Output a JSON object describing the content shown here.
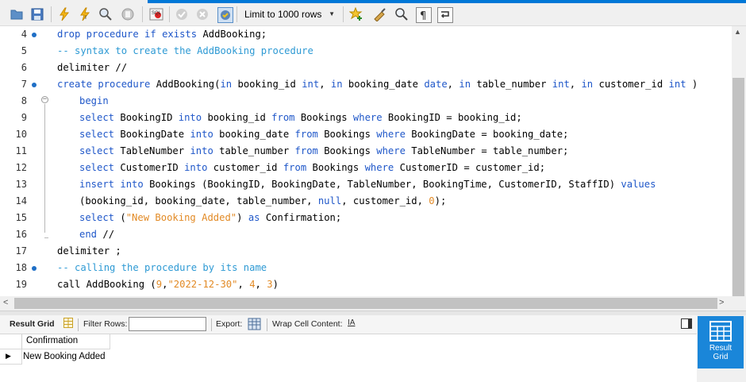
{
  "toolbar": {
    "limit_label": "Limit to 1000 rows",
    "icons": [
      "open-file-icon",
      "save-icon",
      "execute-icon",
      "execute-current-icon",
      "explain-icon",
      "stop-icon",
      "toggle-error-icon",
      "commit-icon",
      "rollback-icon",
      "autocommit-icon",
      "limit-dropdown",
      "bookmark-icon",
      "beautify-icon",
      "find-icon",
      "invisible-chars-icon",
      "wrap-icon"
    ]
  },
  "editor": {
    "lines": [
      {
        "num": "4",
        "marker": true,
        "tokens": [
          [
            "k",
            "drop procedure if exists "
          ],
          [
            "",
            "AddBooking;"
          ]
        ]
      },
      {
        "num": "5",
        "marker": false,
        "tokens": [
          [
            "c",
            "-- syntax to create the AddBooking procedure"
          ]
        ]
      },
      {
        "num": "6",
        "marker": false,
        "tokens": [
          [
            "",
            "delimiter //"
          ]
        ]
      },
      {
        "num": "7",
        "marker": true,
        "tokens": [
          [
            "k",
            "create procedure "
          ],
          [
            "",
            "AddBooking("
          ],
          [
            "k",
            "in "
          ],
          [
            "",
            "booking_id "
          ],
          [
            "k",
            "int"
          ],
          [
            "",
            ", "
          ],
          [
            "k",
            "in "
          ],
          [
            "",
            "booking_date "
          ],
          [
            "k",
            "date"
          ],
          [
            "",
            ", "
          ],
          [
            "k",
            "in "
          ],
          [
            "",
            "table_number "
          ],
          [
            "k",
            "int"
          ],
          [
            "",
            ", "
          ],
          [
            "k",
            "in "
          ],
          [
            "",
            "customer_id "
          ],
          [
            "k",
            "int "
          ],
          [
            "",
            ")"
          ]
        ]
      },
      {
        "num": "8",
        "marker": false,
        "indent": true,
        "fold": true,
        "tokens": [
          [
            "k",
            "begin"
          ]
        ]
      },
      {
        "num": "9",
        "marker": false,
        "indent": true,
        "tokens": [
          [
            "k",
            "select "
          ],
          [
            "",
            "BookingID "
          ],
          [
            "k",
            "into "
          ],
          [
            "",
            "booking_id "
          ],
          [
            "k",
            "from "
          ],
          [
            "",
            "Bookings "
          ],
          [
            "k",
            "where "
          ],
          [
            "",
            "BookingID = booking_id;"
          ]
        ]
      },
      {
        "num": "10",
        "marker": false,
        "indent": true,
        "tokens": [
          [
            "k",
            "select "
          ],
          [
            "",
            "BookingDate "
          ],
          [
            "k",
            "into "
          ],
          [
            "",
            "booking_date "
          ],
          [
            "k",
            "from "
          ],
          [
            "",
            "Bookings "
          ],
          [
            "k",
            "where "
          ],
          [
            "",
            "BookingDate = booking_date;"
          ]
        ]
      },
      {
        "num": "11",
        "marker": false,
        "indent": true,
        "tokens": [
          [
            "k",
            "select "
          ],
          [
            "",
            "TableNumber "
          ],
          [
            "k",
            "into "
          ],
          [
            "",
            "table_number "
          ],
          [
            "k",
            "from "
          ],
          [
            "",
            "Bookings "
          ],
          [
            "k",
            "where "
          ],
          [
            "",
            "TableNumber = table_number;"
          ]
        ]
      },
      {
        "num": "12",
        "marker": false,
        "indent": true,
        "tokens": [
          [
            "k",
            "select "
          ],
          [
            "",
            "CustomerID "
          ],
          [
            "k",
            "into "
          ],
          [
            "",
            "customer_id "
          ],
          [
            "k",
            "from "
          ],
          [
            "",
            "Bookings "
          ],
          [
            "k",
            "where "
          ],
          [
            "",
            "CustomerID = customer_id;"
          ]
        ]
      },
      {
        "num": "13",
        "marker": false,
        "indent": true,
        "tokens": [
          [
            "k",
            "insert into "
          ],
          [
            "",
            "Bookings (BookingID, BookingDate, TableNumber, BookingTime, CustomerID, StaffID) "
          ],
          [
            "k",
            "values"
          ]
        ]
      },
      {
        "num": "14",
        "marker": false,
        "indent": true,
        "tokens": [
          [
            "",
            "(booking_id, booking_date, table_number, "
          ],
          [
            "k",
            "null"
          ],
          [
            "",
            ", customer_id, "
          ],
          [
            "n",
            "0"
          ],
          [
            "",
            ");"
          ]
        ]
      },
      {
        "num": "15",
        "marker": false,
        "indent": true,
        "tokens": [
          [
            "k",
            "select "
          ],
          [
            "",
            "("
          ],
          [
            "s",
            "\"New Booking Added\""
          ],
          [
            "",
            ") "
          ],
          [
            "k",
            "as "
          ],
          [
            "",
            "Confirmation;"
          ]
        ]
      },
      {
        "num": "16",
        "marker": false,
        "indent": true,
        "tokens": [
          [
            "k",
            "end "
          ],
          [
            "",
            "//"
          ]
        ]
      },
      {
        "num": "17",
        "marker": false,
        "tokens": [
          [
            "",
            "delimiter ;"
          ]
        ]
      },
      {
        "num": "18",
        "marker": true,
        "tokens": [
          [
            "c",
            "-- calling the procedure by its name"
          ]
        ]
      },
      {
        "num": "19",
        "marker": false,
        "tokens": [
          [
            "",
            "call AddBooking ("
          ],
          [
            "n",
            "9"
          ],
          [
            "",
            ","
          ],
          [
            "s",
            "\"2022-12-30\""
          ],
          [
            "",
            ", "
          ],
          [
            "n",
            "4"
          ],
          [
            "",
            ", "
          ],
          [
            "n",
            "3"
          ],
          [
            "",
            ")"
          ]
        ]
      }
    ]
  },
  "results_toolbar": {
    "result_grid_label": "Result Grid",
    "filter_rows_label": "Filter Rows:",
    "filter_value": "",
    "export_label": "Export:",
    "wrap_label": "Wrap Cell Content:"
  },
  "grid": {
    "columns": [
      "Confirmation"
    ],
    "rows": [
      [
        "New Booking Added"
      ]
    ]
  },
  "side_panel": {
    "button_label_1": "Result",
    "button_label_2": "Grid"
  },
  "colors": {
    "keyword": "#1f57c9",
    "comment": "#2e9ad4",
    "string": "#e28a25",
    "accent": "#1a86d9"
  }
}
